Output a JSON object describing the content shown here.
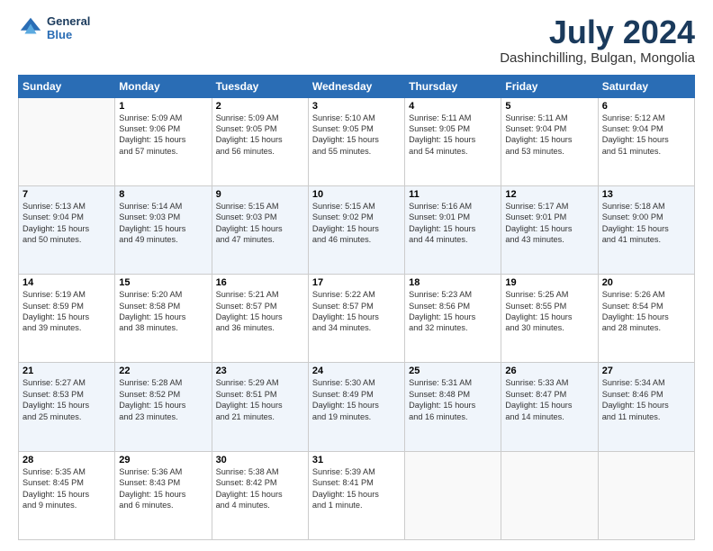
{
  "logo": {
    "line1": "General",
    "line2": "Blue"
  },
  "title": "July 2024",
  "subtitle": "Dashinchilling, Bulgan, Mongolia",
  "days_of_week": [
    "Sunday",
    "Monday",
    "Tuesday",
    "Wednesday",
    "Thursday",
    "Friday",
    "Saturday"
  ],
  "weeks": [
    [
      {
        "day": "",
        "info": ""
      },
      {
        "day": "1",
        "info": "Sunrise: 5:09 AM\nSunset: 9:06 PM\nDaylight: 15 hours\nand 57 minutes."
      },
      {
        "day": "2",
        "info": "Sunrise: 5:09 AM\nSunset: 9:05 PM\nDaylight: 15 hours\nand 56 minutes."
      },
      {
        "day": "3",
        "info": "Sunrise: 5:10 AM\nSunset: 9:05 PM\nDaylight: 15 hours\nand 55 minutes."
      },
      {
        "day": "4",
        "info": "Sunrise: 5:11 AM\nSunset: 9:05 PM\nDaylight: 15 hours\nand 54 minutes."
      },
      {
        "day": "5",
        "info": "Sunrise: 5:11 AM\nSunset: 9:04 PM\nDaylight: 15 hours\nand 53 minutes."
      },
      {
        "day": "6",
        "info": "Sunrise: 5:12 AM\nSunset: 9:04 PM\nDaylight: 15 hours\nand 51 minutes."
      }
    ],
    [
      {
        "day": "7",
        "info": "Sunrise: 5:13 AM\nSunset: 9:04 PM\nDaylight: 15 hours\nand 50 minutes."
      },
      {
        "day": "8",
        "info": "Sunrise: 5:14 AM\nSunset: 9:03 PM\nDaylight: 15 hours\nand 49 minutes."
      },
      {
        "day": "9",
        "info": "Sunrise: 5:15 AM\nSunset: 9:03 PM\nDaylight: 15 hours\nand 47 minutes."
      },
      {
        "day": "10",
        "info": "Sunrise: 5:15 AM\nSunset: 9:02 PM\nDaylight: 15 hours\nand 46 minutes."
      },
      {
        "day": "11",
        "info": "Sunrise: 5:16 AM\nSunset: 9:01 PM\nDaylight: 15 hours\nand 44 minutes."
      },
      {
        "day": "12",
        "info": "Sunrise: 5:17 AM\nSunset: 9:01 PM\nDaylight: 15 hours\nand 43 minutes."
      },
      {
        "day": "13",
        "info": "Sunrise: 5:18 AM\nSunset: 9:00 PM\nDaylight: 15 hours\nand 41 minutes."
      }
    ],
    [
      {
        "day": "14",
        "info": "Sunrise: 5:19 AM\nSunset: 8:59 PM\nDaylight: 15 hours\nand 39 minutes."
      },
      {
        "day": "15",
        "info": "Sunrise: 5:20 AM\nSunset: 8:58 PM\nDaylight: 15 hours\nand 38 minutes."
      },
      {
        "day": "16",
        "info": "Sunrise: 5:21 AM\nSunset: 8:57 PM\nDaylight: 15 hours\nand 36 minutes."
      },
      {
        "day": "17",
        "info": "Sunrise: 5:22 AM\nSunset: 8:57 PM\nDaylight: 15 hours\nand 34 minutes."
      },
      {
        "day": "18",
        "info": "Sunrise: 5:23 AM\nSunset: 8:56 PM\nDaylight: 15 hours\nand 32 minutes."
      },
      {
        "day": "19",
        "info": "Sunrise: 5:25 AM\nSunset: 8:55 PM\nDaylight: 15 hours\nand 30 minutes."
      },
      {
        "day": "20",
        "info": "Sunrise: 5:26 AM\nSunset: 8:54 PM\nDaylight: 15 hours\nand 28 minutes."
      }
    ],
    [
      {
        "day": "21",
        "info": "Sunrise: 5:27 AM\nSunset: 8:53 PM\nDaylight: 15 hours\nand 25 minutes."
      },
      {
        "day": "22",
        "info": "Sunrise: 5:28 AM\nSunset: 8:52 PM\nDaylight: 15 hours\nand 23 minutes."
      },
      {
        "day": "23",
        "info": "Sunrise: 5:29 AM\nSunset: 8:51 PM\nDaylight: 15 hours\nand 21 minutes."
      },
      {
        "day": "24",
        "info": "Sunrise: 5:30 AM\nSunset: 8:49 PM\nDaylight: 15 hours\nand 19 minutes."
      },
      {
        "day": "25",
        "info": "Sunrise: 5:31 AM\nSunset: 8:48 PM\nDaylight: 15 hours\nand 16 minutes."
      },
      {
        "day": "26",
        "info": "Sunrise: 5:33 AM\nSunset: 8:47 PM\nDaylight: 15 hours\nand 14 minutes."
      },
      {
        "day": "27",
        "info": "Sunrise: 5:34 AM\nSunset: 8:46 PM\nDaylight: 15 hours\nand 11 minutes."
      }
    ],
    [
      {
        "day": "28",
        "info": "Sunrise: 5:35 AM\nSunset: 8:45 PM\nDaylight: 15 hours\nand 9 minutes."
      },
      {
        "day": "29",
        "info": "Sunrise: 5:36 AM\nSunset: 8:43 PM\nDaylight: 15 hours\nand 6 minutes."
      },
      {
        "day": "30",
        "info": "Sunrise: 5:38 AM\nSunset: 8:42 PM\nDaylight: 15 hours\nand 4 minutes."
      },
      {
        "day": "31",
        "info": "Sunrise: 5:39 AM\nSunset: 8:41 PM\nDaylight: 15 hours\nand 1 minute."
      },
      {
        "day": "",
        "info": ""
      },
      {
        "day": "",
        "info": ""
      },
      {
        "day": "",
        "info": ""
      }
    ]
  ]
}
